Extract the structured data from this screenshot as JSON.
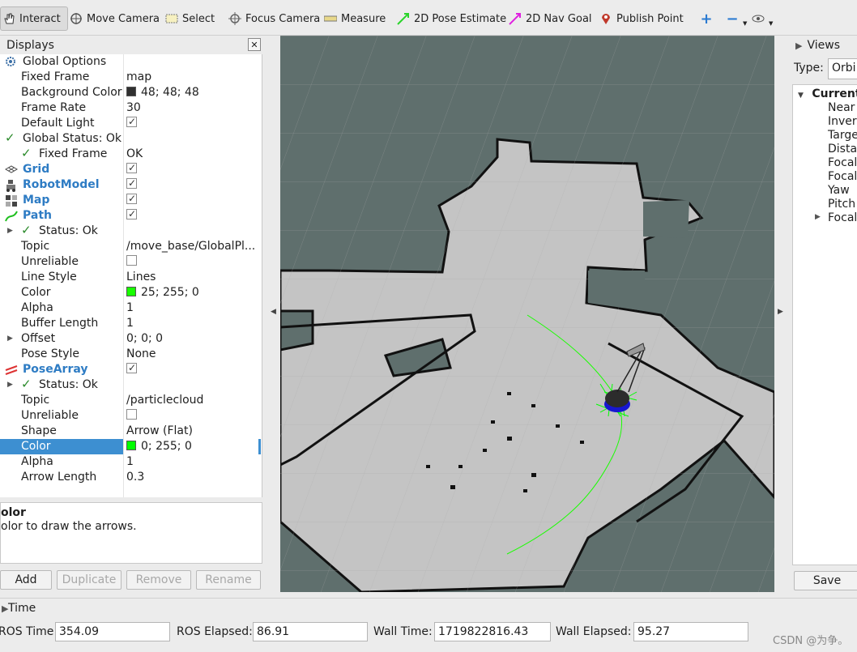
{
  "toolbar": {
    "interact": "Interact",
    "move_camera": "Move Camera",
    "select": "Select",
    "focus_camera": "Focus Camera",
    "measure": "Measure",
    "pose_estimate": "2D Pose Estimate",
    "nav_goal": "2D Nav Goal",
    "publish_point": "Publish Point"
  },
  "displays": {
    "title": "Displays",
    "rows": [
      {
        "key": "Global Options",
        "value": ""
      },
      {
        "key": "Fixed Frame",
        "value": "map"
      },
      {
        "key": "Background Color",
        "value": "48; 48; 48"
      },
      {
        "key": "Frame Rate",
        "value": "30"
      },
      {
        "key": "Default Light",
        "value": ""
      },
      {
        "key": "Global Status: Ok",
        "value": ""
      },
      {
        "key": "Fixed Frame",
        "value": "OK"
      },
      {
        "key": "Grid",
        "value": ""
      },
      {
        "key": "RobotModel",
        "value": ""
      },
      {
        "key": "Map",
        "value": ""
      },
      {
        "key": "Path",
        "value": ""
      },
      {
        "key": "Status: Ok",
        "value": ""
      },
      {
        "key": "Topic",
        "value": "/move_base/GlobalPl..."
      },
      {
        "key": "Unreliable",
        "value": ""
      },
      {
        "key": "Line Style",
        "value": "Lines"
      },
      {
        "key": "Color",
        "value": "25; 255; 0"
      },
      {
        "key": "Alpha",
        "value": "1"
      },
      {
        "key": "Buffer Length",
        "value": "1"
      },
      {
        "key": "Offset",
        "value": "0; 0; 0"
      },
      {
        "key": "Pose Style",
        "value": "None"
      },
      {
        "key": "PoseArray",
        "value": ""
      },
      {
        "key": "Status: Ok",
        "value": ""
      },
      {
        "key": "Topic",
        "value": "/particlecloud"
      },
      {
        "key": "Unreliable",
        "value": ""
      },
      {
        "key": "Shape",
        "value": "Arrow (Flat)"
      },
      {
        "key": "Color",
        "value": "0; 255; 0"
      },
      {
        "key": "Alpha",
        "value": "1"
      },
      {
        "key": "Arrow Length",
        "value": "0.3"
      }
    ],
    "desc_title": "olor",
    "desc_text": "olor to draw the arrows."
  },
  "buttons": {
    "add": "Add",
    "duplicate": "Duplicate",
    "remove": "Remove",
    "rename": "Rename"
  },
  "views": {
    "title": "Views",
    "type_label": "Type:",
    "type_value": "Orbi",
    "current": "Current",
    "items": [
      "Near",
      "Invert",
      "Targe",
      "Dista",
      "Focal",
      "Focal",
      "Yaw",
      "Pitch",
      "Focal"
    ],
    "save": "Save"
  },
  "time": {
    "title": "Time",
    "ros_time_label": "ROS Time:",
    "ros_time": "354.09",
    "ros_elapsed_label": "ROS Elapsed:",
    "ros_elapsed": "86.91",
    "wall_time_label": "Wall Time:",
    "wall_time": "1719822816.43",
    "wall_elapsed_label": "Wall Elapsed:",
    "wall_elapsed": "95.27"
  },
  "watermark": "CSDN @为争。",
  "colors": {
    "background": "#303030",
    "path": "#19ff00",
    "pose": "#00ff00",
    "selection": "#3d8fd1"
  }
}
